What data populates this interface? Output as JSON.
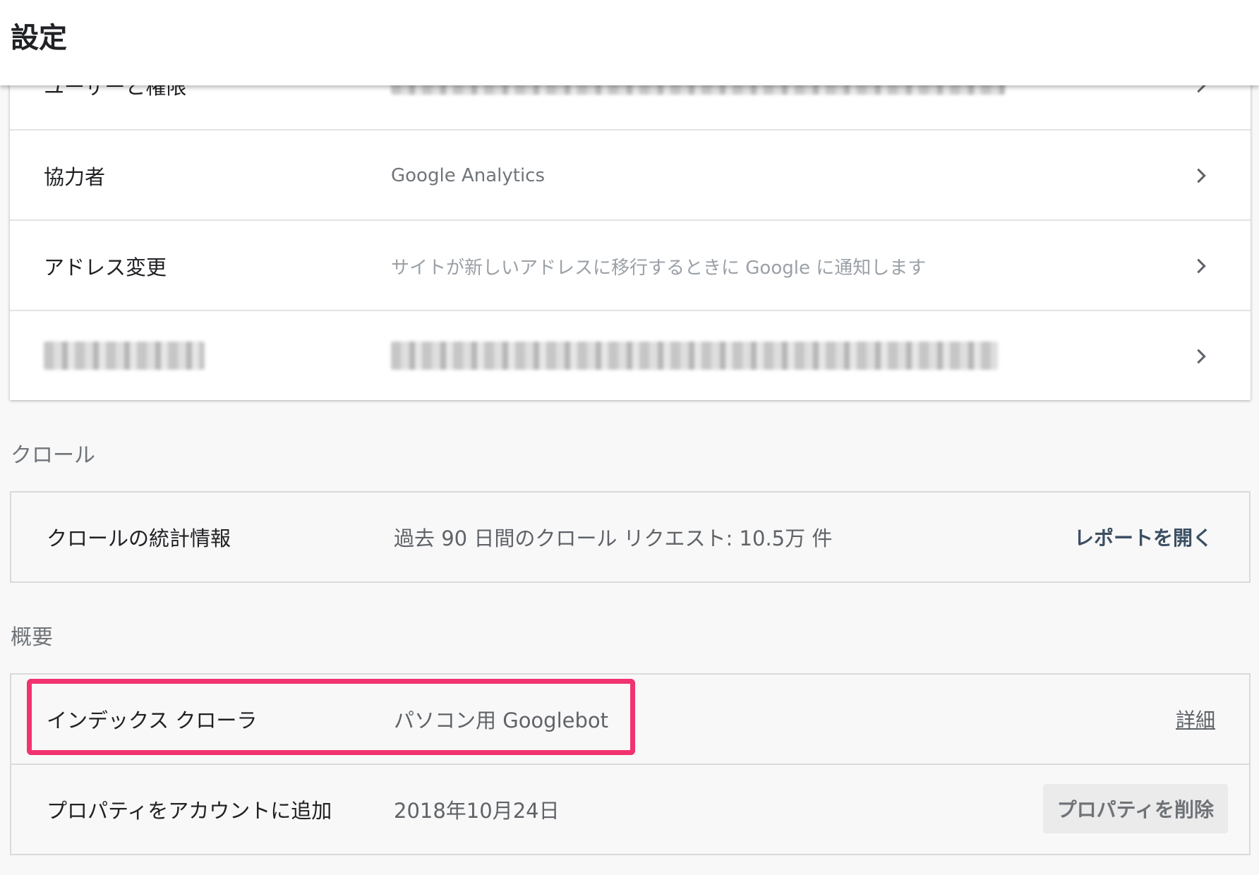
{
  "header": {
    "title": "設定"
  },
  "settings_list": {
    "items": [
      {
        "label": "ユーザーと権限",
        "value": "",
        "value_blurred": true
      },
      {
        "label": "協力者",
        "value": "Google Analytics"
      },
      {
        "label": "アドレス変更",
        "value": "サイトが新しいアドレスに移行するときに Google に通知します"
      },
      {
        "label": "",
        "label_blurred": true,
        "value": "",
        "value_blurred": true
      }
    ]
  },
  "crawl_section": {
    "heading": "クロール",
    "stats_row": {
      "label": "クロールの統計情報",
      "value": "過去 90 日間のクロール リクエスト: 10.5万 件",
      "action_label": "レポートを開く"
    }
  },
  "overview_section": {
    "heading": "概要",
    "index_crawler_row": {
      "label": "インデックス クローラ",
      "value": "パソコン用 Googlebot",
      "action_label": "詳細"
    },
    "added_row": {
      "label": "プロパティをアカウントに追加",
      "value": "2018年10月24日",
      "action_label": "プロパティを削除"
    }
  },
  "icons": {
    "chevron": "chevron-right-icon"
  },
  "colors": {
    "highlight": "#f1336f",
    "link": "#3c4f63"
  }
}
